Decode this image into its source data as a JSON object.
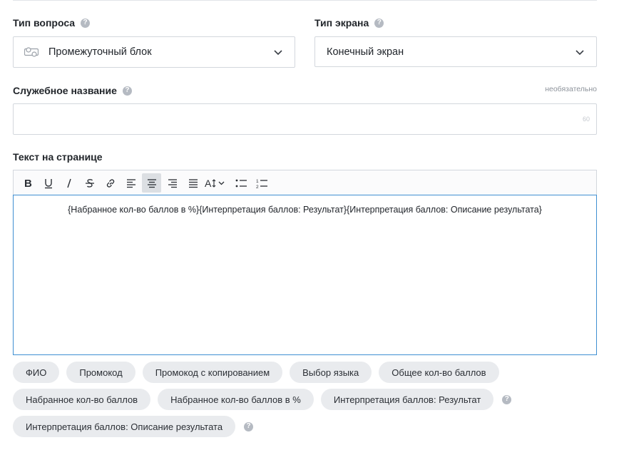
{
  "question_type": {
    "label": "Тип вопроса",
    "value": "Промежуточный блок",
    "icon": "block-icon"
  },
  "screen_type": {
    "label": "Тип экрана",
    "value": "Конечный экран"
  },
  "service_name": {
    "label": "Служебное название",
    "optional": "необязательно",
    "value": "",
    "counter": "60"
  },
  "page_text": {
    "label": "Текст на странице",
    "content": "{Набранное кол-во баллов в %}{Интерпретация баллов: Результат}{Интерпретация баллов: Описание результата}"
  },
  "toolbar": {
    "tools": [
      "bold",
      "underline",
      "italic",
      "strikethrough",
      "link",
      "align-left",
      "align-center",
      "align-right",
      "align-justify",
      "font-size",
      "bullet-list",
      "numbered-list"
    ],
    "active": "align-center"
  },
  "variables": {
    "row1": [
      "ФИО",
      "Промокод",
      "Промокод с копированием",
      "Выбор языка",
      "Общее кол-во баллов"
    ],
    "row2": [
      "Набранное кол-во баллов",
      "Набранное кол-во баллов в %",
      "Интерпретация баллов: Результат"
    ],
    "row3": [
      "Интерпретация баллов: Описание результата"
    ]
  },
  "colors": {
    "accent_border": "#3f8fd2",
    "chip_bg": "#e9ebee",
    "help_icon": "#b5bac2"
  }
}
